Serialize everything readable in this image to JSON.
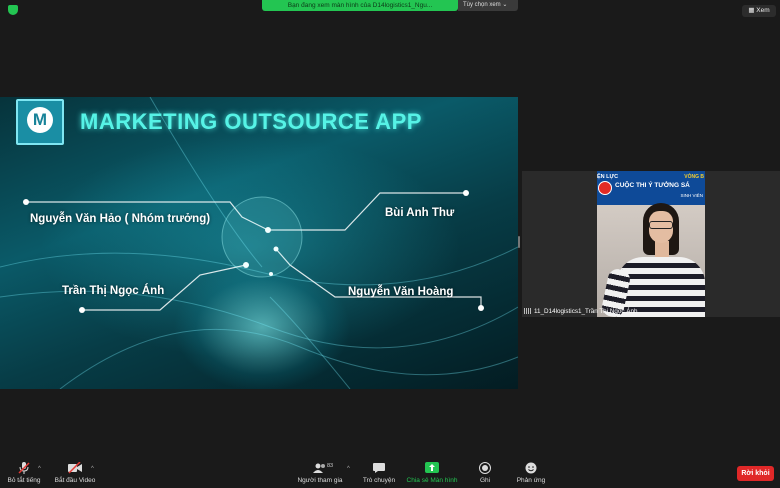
{
  "top_bar": {
    "share_banner": "Bạn đang xem màn hình của D14logistics1_Ngu...",
    "view_options": "Tùy chọn xem",
    "view_options_caret": "⌄",
    "view_button": "Xem"
  },
  "slide": {
    "logo_letter": "M",
    "title": "MARKETING OUTSOURCE APP",
    "members": [
      "Nguyễn Văn Hảo ( Nhóm trưởng)",
      "Bùi Anh Thư",
      "Trần Thị Ngọc Ánh",
      "Nguyễn Văn Hoàng"
    ]
  },
  "participant": {
    "name": "11_D14logistics1_Trần Thị Ngọc Ánh",
    "banner": {
      "left_text": "ỆN LỰC",
      "right_text": "VÒNG B",
      "contest": "CUỘC THI Ý TƯỞNG SÁ",
      "subtitle": "SINH VIÊN"
    }
  },
  "toolbar": {
    "mute": "Bỏ tắt tiếng",
    "start_video": "Bắt đầu Video",
    "participants": "Người tham gia",
    "participants_count": "83",
    "chat": "Trò chuyện",
    "share_screen": "Chia sẻ Màn hình",
    "record": "Ghi",
    "reactions": "Phản ứng",
    "leave": "Rời khỏi",
    "caret": "^"
  },
  "colors": {
    "share_green": "#23c552",
    "leave_red": "#e02828",
    "title_cyan": "#56f3e6"
  }
}
